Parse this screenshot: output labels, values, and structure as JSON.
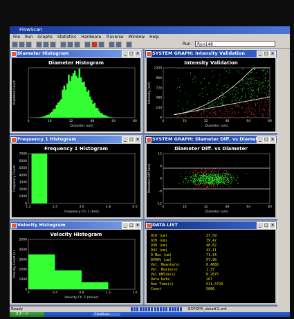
{
  "app": {
    "title": "FlowScan"
  },
  "menu": [
    "File",
    "Run",
    "Graphs",
    "Statistics",
    "Hardware",
    "Traverse",
    "Window",
    "Help"
  ],
  "toolbar": {
    "run_label": "Run",
    "run_value": "Run148"
  },
  "windows": {
    "diameter": {
      "title": "Diameter Histogram"
    },
    "intensity": {
      "title": "SYSTEM GRAPH: Intensity Validation"
    },
    "frequency": {
      "title": "Frequency 1 Histogram"
    },
    "diffdiam": {
      "title": "SYSTEM GRAPH: Diameter Diff. vs Diameter"
    },
    "velocity": {
      "title": "Velocity Histogram"
    },
    "datalist": {
      "title": "DATA LIST"
    }
  },
  "chart_data": [
    {
      "type": "bar",
      "title": "Diameter Histogram",
      "xlabel": "Diameter (um)",
      "ylabel": "Validated Count",
      "xlim": [
        0,
        80
      ],
      "x_ticks": [
        "0",
        "16",
        "32",
        "48",
        "64",
        "80"
      ],
      "y_ticks": [],
      "color": "#33ff33",
      "shape": "bell",
      "peak_x": 35
    },
    {
      "type": "scatter",
      "title": "Intensity Validation",
      "xlabel": "Diameter (um)",
      "ylabel": "Intensity (mV)",
      "xlim": [
        0,
        80
      ],
      "ylim": [
        0,
        1200
      ],
      "x_ticks": [
        "0",
        "16",
        "32",
        "48",
        "64",
        "80"
      ],
      "y_ticks": [
        "0",
        "240",
        "480",
        "720",
        "960",
        "1200"
      ],
      "series": [
        {
          "color": "#33ff33",
          "region": "above threshold"
        },
        {
          "color": "#ff3030",
          "region": "below threshold"
        }
      ]
    },
    {
      "type": "bar",
      "title": "Frequency 1 Histogram",
      "xlabel": "Frequency Ch. 1 (kHz)",
      "ylabel": "Frequency Count",
      "xlim": [
        1.2,
        8.0
      ],
      "ylim": [
        0,
        7000
      ],
      "x_ticks": [
        "1.2",
        "2.4",
        "3.6",
        "4.8",
        "6.0"
      ],
      "y_ticks": [
        "0",
        "1000",
        "2000",
        "3000",
        "4000",
        "5000",
        "6000",
        "7000"
      ],
      "bars": [
        {
          "x0": 1.4,
          "x1": 2.4,
          "value": 7000
        }
      ],
      "color": "#33ff33"
    },
    {
      "type": "scatter",
      "title": "Diameter Diff. vs Diameter",
      "xlabel": "Diameter (um)",
      "ylabel": "Diameter Diff (um)",
      "xlim": [
        0,
        80
      ],
      "ylim": [
        -12,
        12
      ],
      "x_ticks": [
        "0",
        "16",
        "32",
        "48",
        "64",
        "80"
      ],
      "y_ticks": [
        "-12",
        "-6",
        "0",
        "6",
        "12"
      ],
      "series": [
        {
          "color": "#33ff33",
          "region": "inside limits"
        },
        {
          "color": "#ff3030",
          "region": "outside limits"
        }
      ]
    },
    {
      "type": "bar",
      "title": "Velocity Histogram",
      "xlabel": "Velocity Ch. 1 (m/sec)",
      "ylabel": "Velocity Count (n)",
      "xlim": [
        0,
        1.6
      ],
      "ylim": [
        0,
        5000
      ],
      "x_ticks": [
        "0",
        "0.4",
        "0.8",
        "1.2",
        "1.6"
      ],
      "y_ticks": [
        "0",
        "1000",
        "2000",
        "3000",
        "4000",
        "5000"
      ],
      "bars": [
        {
          "x0": 0.0,
          "x1": 0.4,
          "value": 3500
        },
        {
          "x0": 0.4,
          "x1": 0.8,
          "value": 1900
        },
        {
          "x0": 0.8,
          "x1": 1.2,
          "value": 700
        }
      ],
      "color": "#33ff33"
    }
  ],
  "data_list": [
    {
      "label": "D10 (um)",
      "value": "37.59"
    },
    {
      "label": "D20 (um)",
      "value": "39.42"
    },
    {
      "label": "D30 (um)",
      "value": "40.62"
    },
    {
      "label": "D32 (um)",
      "value": "43.11"
    },
    {
      "label": "D Max (um)",
      "value": "71.44"
    },
    {
      "label": "DV90% (um)",
      "value": "57.98"
    },
    {
      "label": "Vel. Mean(m/s)",
      "value": "0.4666"
    },
    {
      "label": "Vel. Max(m/s)",
      "value": "1.37"
    },
    {
      "label": "Vel.RMS(m/s)",
      "value": "0.2075"
    },
    {
      "label": "Data Rate",
      "value": "267"
    },
    {
      "label": "Run Time(s)",
      "value": "511.3720"
    },
    {
      "label": "Count",
      "value": "5000"
    }
  ],
  "status": {
    "text": "Ready",
    "file": "EXPOPA_data#1.ord"
  },
  "taskbar": {
    "start": "スタート",
    "item": "FlowScan"
  }
}
